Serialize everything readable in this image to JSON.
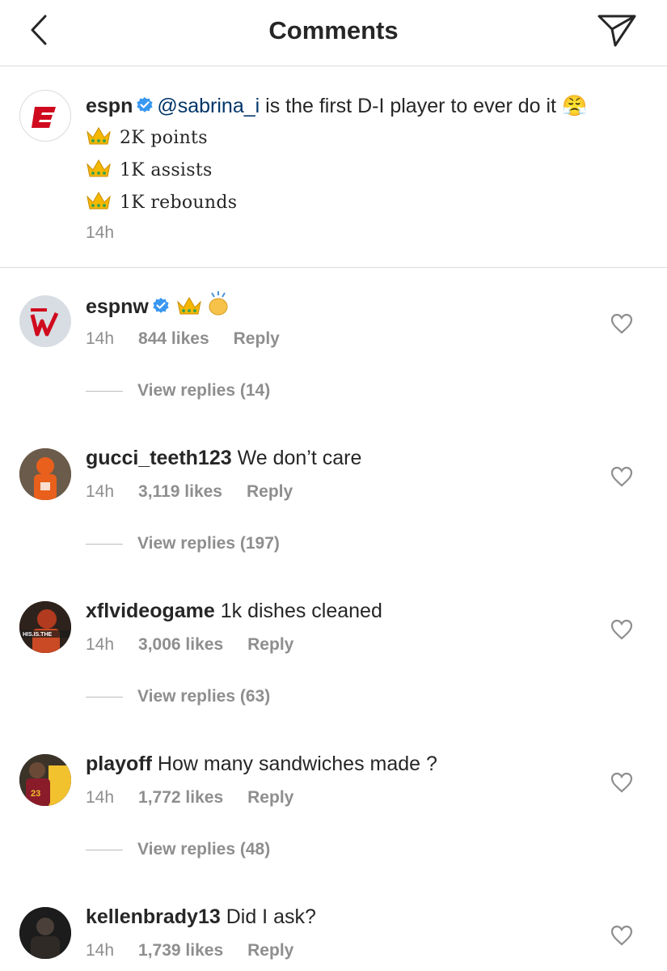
{
  "header": {
    "title": "Comments",
    "back_icon": "chevron-left-icon",
    "send_icon": "paper-plane-icon"
  },
  "caption": {
    "username": "espn",
    "mention": "@sabrina_i",
    "text": " is the first D-I player to ever do it",
    "emoji": "😤",
    "stats": [
      "2K points",
      "1K assists",
      "1K rebounds"
    ],
    "time": "14h"
  },
  "comments": [
    {
      "username": "espnw",
      "text": "",
      "time": "14h",
      "likes": "844 likes",
      "reply": "Reply",
      "view_replies": "View replies (14)"
    },
    {
      "username": "gucci_teeth123",
      "text": "We don’t care",
      "time": "14h",
      "likes": "3,119 likes",
      "reply": "Reply",
      "view_replies": "View replies (197)"
    },
    {
      "username": "xflvideogame",
      "text": "1k dishes cleaned",
      "time": "14h",
      "likes": "3,006 likes",
      "reply": "Reply",
      "view_replies": "View replies (63)"
    },
    {
      "username": "playoff",
      "text": "How many sandwiches made ?",
      "time": "14h",
      "likes": "1,772 likes",
      "reply": "Reply",
      "view_replies": "View replies (48)"
    },
    {
      "username": "kellenbrady13",
      "text": "Did I ask?",
      "time": "14h",
      "likes": "1,739 likes",
      "reply": "Reply"
    }
  ],
  "colors": {
    "verified": "#3897f0",
    "mention": "#003569",
    "espn_red": "#d00a1e",
    "muted": "#8e8e8e"
  }
}
